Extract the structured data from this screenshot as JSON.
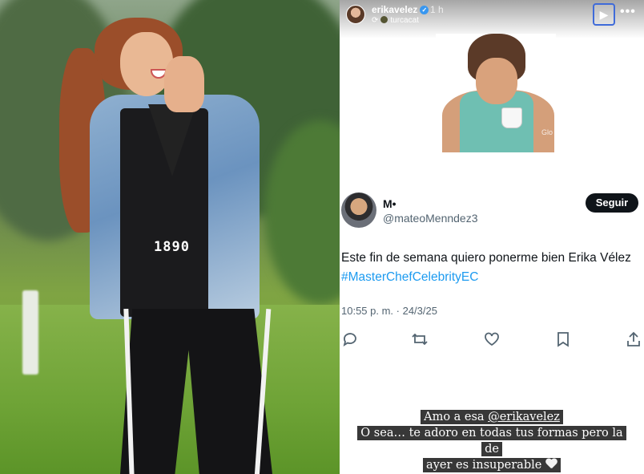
{
  "story": {
    "username": "erikavelez",
    "time": "1 h",
    "song": "turcacat",
    "play_icon": "play-icon",
    "more_icon": "more-icon"
  },
  "photo": {
    "jacket_text": "1890"
  },
  "tweet": {
    "name": "M•",
    "handle": "@mateoMenndez3",
    "follow_label": "Seguir",
    "text_before": "Este fin de semana quiero ponerme bien Erika Vélez ",
    "hashtag": "#MasterChefCelebrityEC",
    "meta": "10:55 p. m. · 24/3/25",
    "gif_watermark": "Glo"
  },
  "caption": {
    "line1_prefix": "Amo a esa ",
    "line1_mention": "@erikavelez",
    "line2": "O sea… te adoro en todas tus formas pero la de",
    "line3": "ayer es insuperable"
  },
  "colors": {
    "hashtag": "#1d9bf0",
    "follow_bg": "#0f1419",
    "verified": "#3897f0"
  }
}
